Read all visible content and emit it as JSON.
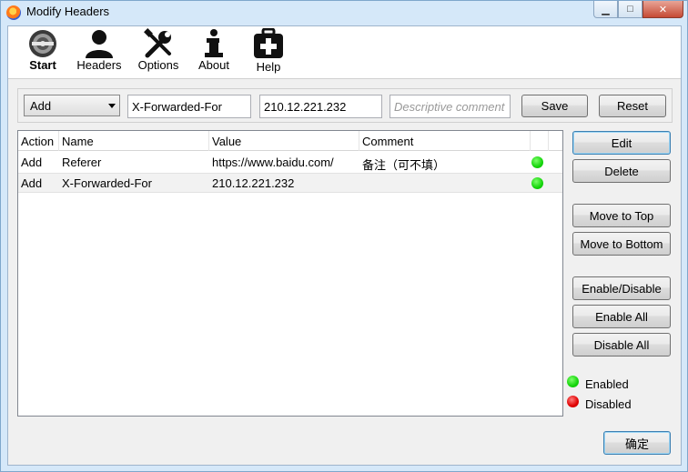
{
  "window": {
    "title": "Modify Headers",
    "minimize": "▁",
    "maximize": "□",
    "close": "✕"
  },
  "toolbar": {
    "items": [
      {
        "label": "Start",
        "icon": "start-icon"
      },
      {
        "label": "Headers",
        "icon": "user-icon"
      },
      {
        "label": "Options",
        "icon": "tools-icon"
      },
      {
        "label": "About",
        "icon": "info-icon"
      },
      {
        "label": "Help",
        "icon": "first-aid-icon"
      }
    ]
  },
  "form": {
    "action_selected": "Add",
    "name_value": "X-Forwarded-For",
    "value_value": "210.12.221.232",
    "comment_placeholder": "Descriptive comment",
    "save_label": "Save",
    "reset_label": "Reset"
  },
  "table": {
    "columns": [
      "Action",
      "Name",
      "Value",
      "Comment"
    ],
    "rows": [
      {
        "action": "Add",
        "name": "Referer",
        "value": "https://www.baidu.com/",
        "comment": "备注（可不填）",
        "status": "enabled"
      },
      {
        "action": "Add",
        "name": "X-Forwarded-For",
        "value": "210.12.221.232",
        "comment": "",
        "status": "enabled"
      }
    ]
  },
  "side_buttons": {
    "edit": "Edit",
    "delete": "Delete",
    "move_top": "Move to Top",
    "move_bottom": "Move to Bottom",
    "enable_disable": "Enable/Disable",
    "enable_all": "Enable All",
    "disable_all": "Disable All"
  },
  "legend": {
    "enabled": "Enabled",
    "disabled": "Disabled"
  },
  "ok_label": "确定",
  "colors": {
    "enabled": "#14d40a",
    "disabled": "#e00000",
    "focus_border": "#3c7fb1"
  }
}
